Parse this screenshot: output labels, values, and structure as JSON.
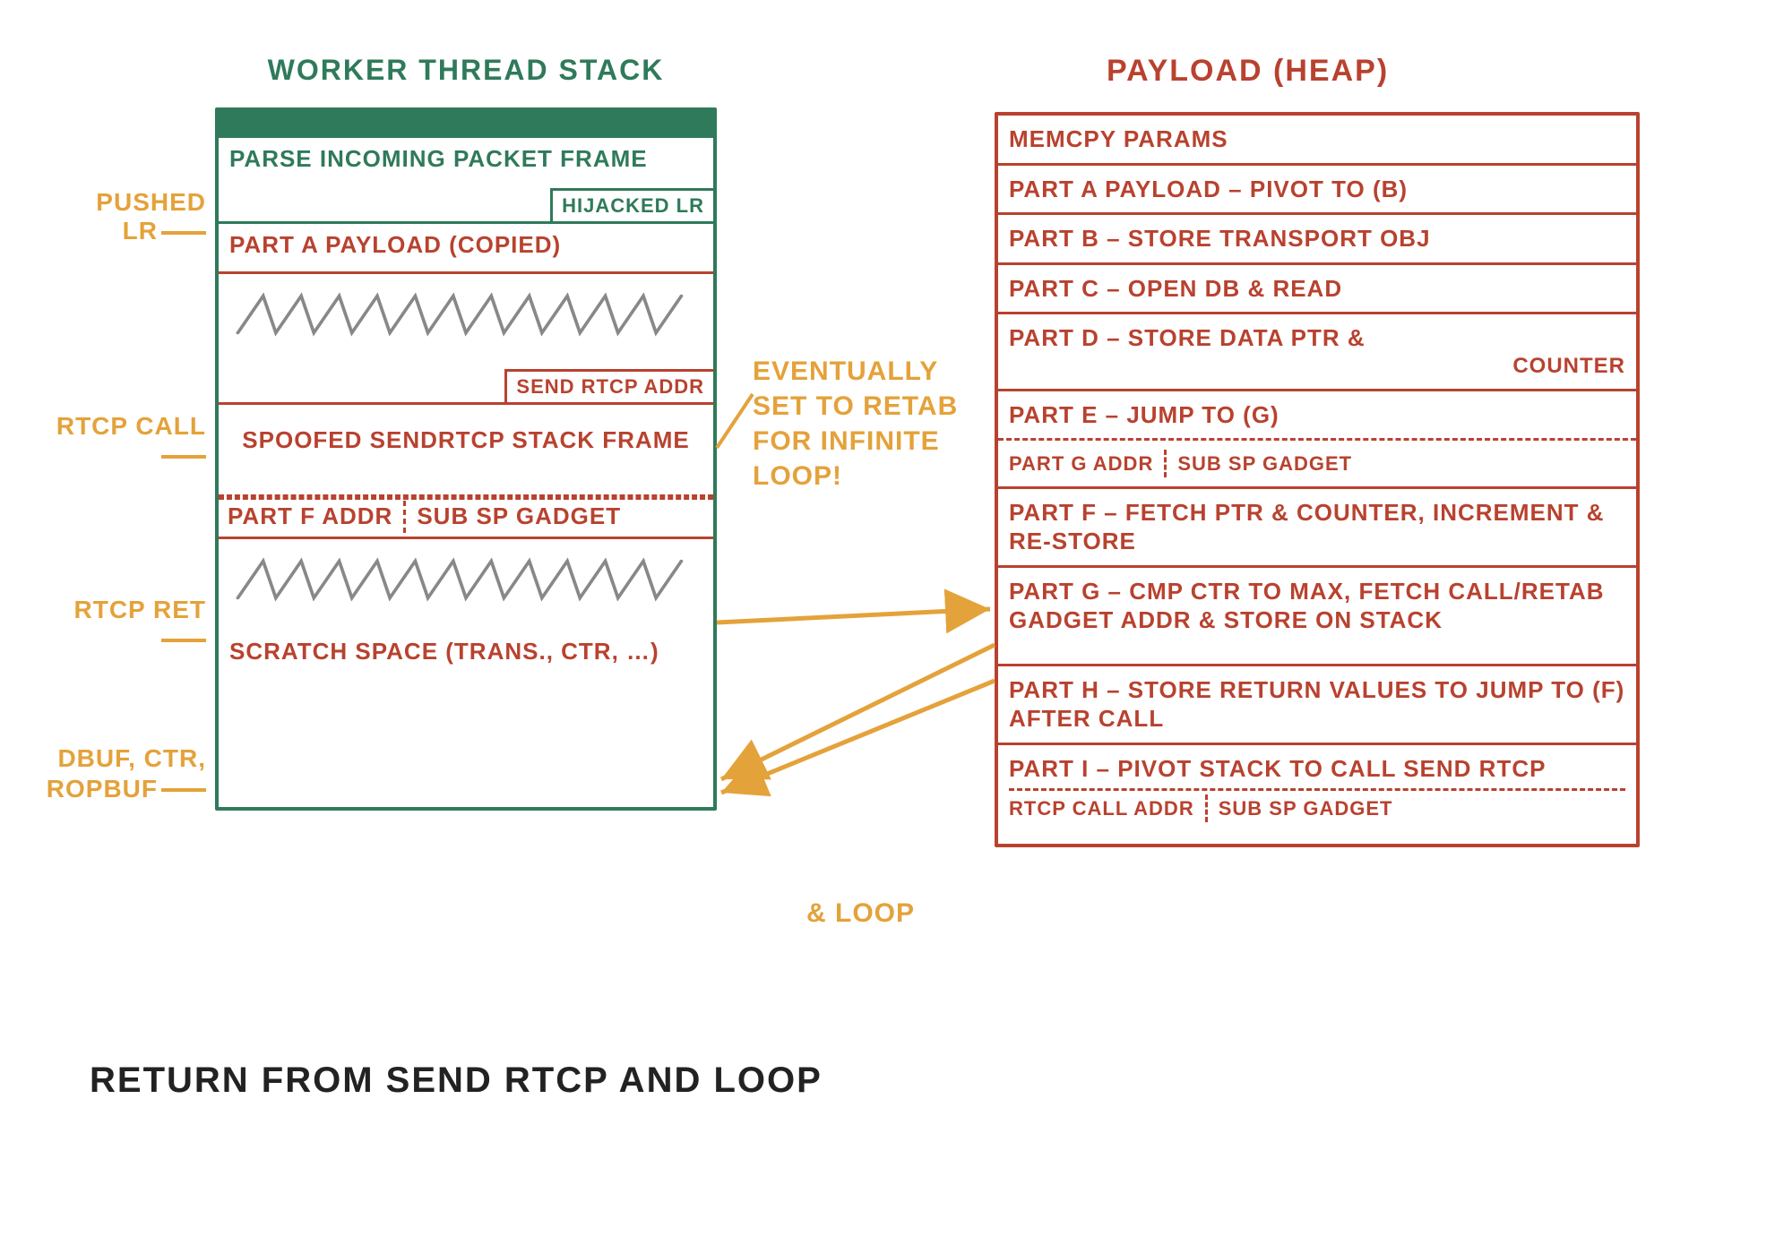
{
  "colors": {
    "green": "#2f7a5a",
    "red": "#b8422f",
    "orange": "#e4a23a",
    "black": "#222222",
    "grey": "#888888"
  },
  "stack": {
    "title": "WORKER THREAD STACK",
    "rows": {
      "parse_frame": "PARSE INCOMING PACKET FRAME",
      "hijacked_lr": "HIJACKED LR",
      "part_a_copied": "PART A PAYLOAD (COPIED)",
      "send_rtcp_addr": "SEND RTCP ADDR",
      "spoofed_frame": "SPOOFED SENDRTCP STACK FRAME",
      "part_f_addr": "PART F ADDR",
      "sub_sp_gadget": "SUB SP GADGET",
      "scratch": "SCRATCH SPACE (TRANS., CTR, …)"
    }
  },
  "heap": {
    "title": "PAYLOAD (HEAP)",
    "rows": {
      "memcpy": "MEMCPY PARAMS",
      "part_a": "PART A PAYLOAD – PIVOT TO (B)",
      "part_b": "PART B – STORE TRANSPORT OBJ",
      "part_c": "PART C – OPEN DB & READ",
      "part_d_line1": "PART D – STORE DATA PTR &",
      "part_d_line2": "COUNTER",
      "part_e": "PART E – JUMP TO (G)",
      "part_g_addr": "PART G ADDR",
      "part_g_gadget": "SUB SP GADGET",
      "part_f": "PART F – FETCH PTR & COUNTER, INCREMENT & RE-STORE",
      "part_g": "PART G – CMP CTR TO MAX, FETCH CALL/RETAB GADGET ADDR & STORE ON STACK",
      "part_h": "PART H – STORE RETURN VALUES TO JUMP TO (F) AFTER CALL",
      "part_i_line1": "PART I – PIVOT STACK TO CALL SEND RTCP",
      "part_i_addr": "RTCP CALL ADDR",
      "part_i_gadget": "SUB SP GADGET"
    }
  },
  "annotations": {
    "pushed_lr": "PUSHED LR",
    "rtcp_call": "RTCP CALL",
    "rtcp_ret": "RTCP RET",
    "dbuf": "DBUF, CTR, ROPBUF",
    "eventually": "EVENTUALLY SET TO RETAB FOR INFINITE LOOP!",
    "and_loop": "& LOOP"
  },
  "caption": "RETURN FROM SEND RTCP AND LOOP",
  "chart_data": {
    "type": "table",
    "title": "ROP exploit memory layout: worker-thread stack vs payload heap",
    "stack_frames": [
      {
        "label": "PARSE INCOMING PACKET FRAME",
        "extra": "HIJACKED LR",
        "annotation": "PUSHED LR",
        "color": "green"
      },
      {
        "label": "PART A PAYLOAD (COPIED)",
        "color": "red"
      },
      {
        "label": "(scribbled / unused)",
        "extra": "SEND RTCP ADDR",
        "annotation": "RTCP CALL",
        "note": "EVENTUALLY SET TO RETAB FOR INFINITE LOOP!",
        "color": "red"
      },
      {
        "label": "SPOOFED SENDRTCP STACK FRAME",
        "extra": "PART F ADDR | SUB SP GADGET",
        "annotation": "RTCP RET",
        "color": "red"
      },
      {
        "label": "(scribbled / unused)",
        "color": "grey"
      },
      {
        "label": "SCRATCH SPACE (TRANS., CTR, …)",
        "annotation": "DBUF, CTR, ROPBUF",
        "color": "red"
      }
    ],
    "heap_blocks": [
      "MEMCPY PARAMS",
      "PART A PAYLOAD – PIVOT TO (B)",
      "PART B – STORE TRANSPORT OBJ",
      "PART C – OPEN DB & READ",
      "PART D – STORE DATA PTR & COUNTER",
      "PART E – JUMP TO (G)  [PART G ADDR | SUB SP GADGET]",
      "PART F – FETCH PTR & COUNTER, INCREMENT & RE-STORE",
      "PART G – CMP CTR TO MAX, FETCH CALL/RETAB GADGET ADDR & STORE ON STACK",
      "PART H – STORE RETURN VALUES TO JUMP TO (F) AFTER CALL",
      "PART I – PIVOT STACK TO CALL SEND RTCP  [RTCP CALL ADDR | SUB SP GADGET]"
    ],
    "arrows": [
      {
        "from": "stack: PART F ADDR | SUB SP GADGET",
        "to": "heap: PART F block",
        "meaning": "return pivots into heap ROP chain"
      },
      {
        "from": "heap: PART F block",
        "to": "stack: SCRATCH SPACE",
        "meaning": "writes ptr & counter back to scratch"
      },
      {
        "from": "heap: PART F block",
        "to": "stack: SCRATCH SPACE (second)",
        "meaning": "re-store counter"
      },
      {
        "from": "stack: SEND RTCP ADDR",
        "to": "note: EVENTUALLY SET TO RETAB FOR INFINITE LOOP!",
        "meaning": "annotation"
      }
    ],
    "caption": "RETURN FROM SEND RTCP AND LOOP  (& LOOP)"
  }
}
